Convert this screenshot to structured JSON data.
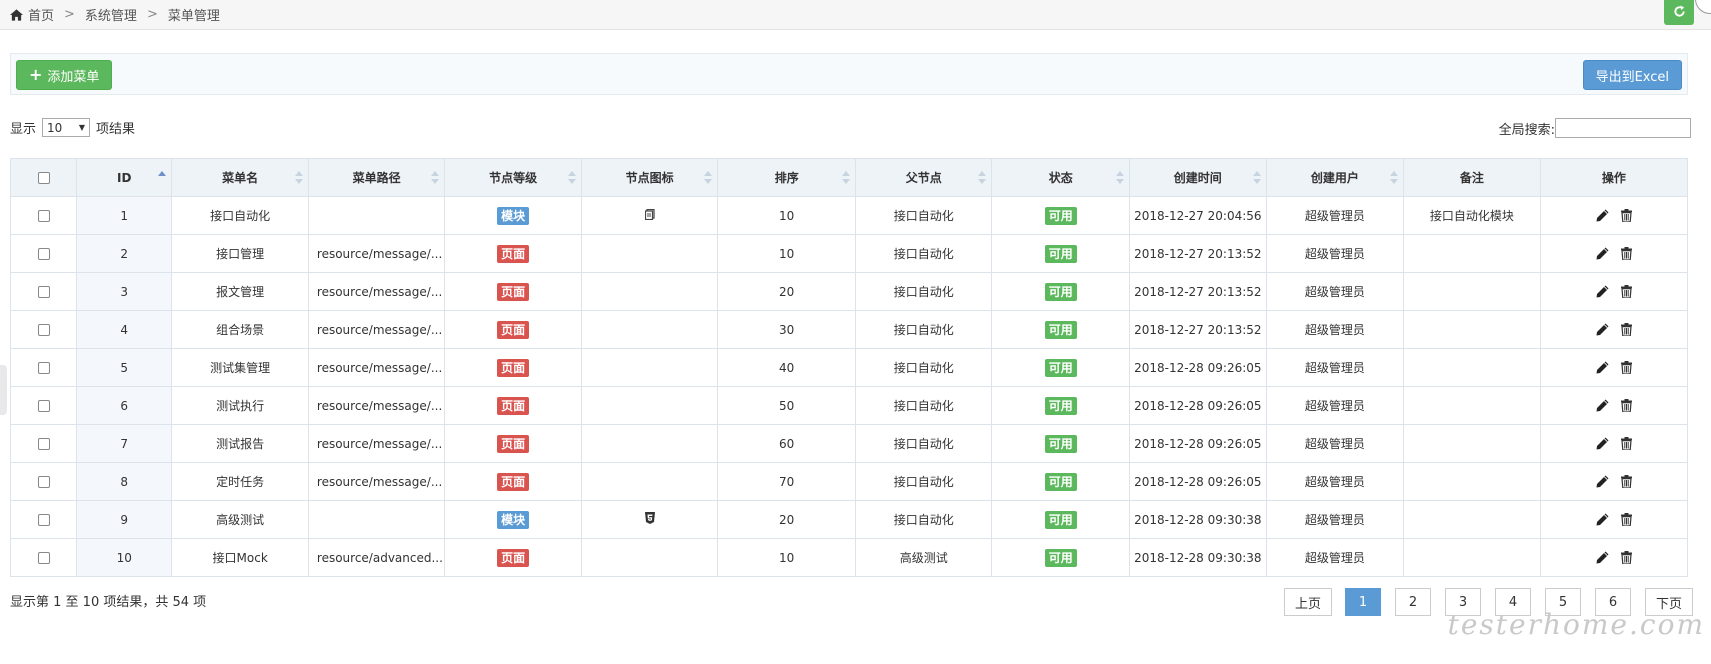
{
  "breadcrumb": {
    "home": "首页",
    "sep1": ">",
    "level1": "系统管理",
    "sep2": ">",
    "level2": "菜单管理"
  },
  "toolbar": {
    "add_label": "添加菜单",
    "export_label": "导出到Excel"
  },
  "length": {
    "prefix": "显示",
    "value": "10",
    "suffix": "项结果"
  },
  "search": {
    "label": "全局搜索:",
    "value": ""
  },
  "table": {
    "columns": [
      "ID",
      "菜单名",
      "菜单路径",
      "节点等级",
      "节点图标",
      "排序",
      "父节点",
      "状态",
      "创建时间",
      "创建用户",
      "备注",
      "操作"
    ],
    "rows": [
      {
        "id": "1",
        "name": "接口自动化",
        "path": "",
        "level": "模块",
        "icon": "file-icon",
        "order": "10",
        "parent": "接口自动化",
        "status": "可用",
        "created": "2018-12-27 20:04:56",
        "user": "超级管理员",
        "note": "接口自动化模块"
      },
      {
        "id": "2",
        "name": "接口管理",
        "path": "resource/message/...",
        "level": "页面",
        "icon": "",
        "order": "10",
        "parent": "接口自动化",
        "status": "可用",
        "created": "2018-12-27 20:13:52",
        "user": "超级管理员",
        "note": ""
      },
      {
        "id": "3",
        "name": "报文管理",
        "path": "resource/message/...",
        "level": "页面",
        "icon": "",
        "order": "20",
        "parent": "接口自动化",
        "status": "可用",
        "created": "2018-12-27 20:13:52",
        "user": "超级管理员",
        "note": ""
      },
      {
        "id": "4",
        "name": "组合场景",
        "path": "resource/message/...",
        "level": "页面",
        "icon": "",
        "order": "30",
        "parent": "接口自动化",
        "status": "可用",
        "created": "2018-12-27 20:13:52",
        "user": "超级管理员",
        "note": ""
      },
      {
        "id": "5",
        "name": "测试集管理",
        "path": "resource/message/...",
        "level": "页面",
        "icon": "",
        "order": "40",
        "parent": "接口自动化",
        "status": "可用",
        "created": "2018-12-28 09:26:05",
        "user": "超级管理员",
        "note": ""
      },
      {
        "id": "6",
        "name": "测试执行",
        "path": "resource/message/...",
        "level": "页面",
        "icon": "",
        "order": "50",
        "parent": "接口自动化",
        "status": "可用",
        "created": "2018-12-28 09:26:05",
        "user": "超级管理员",
        "note": ""
      },
      {
        "id": "7",
        "name": "测试报告",
        "path": "resource/message/...",
        "level": "页面",
        "icon": "",
        "order": "60",
        "parent": "接口自动化",
        "status": "可用",
        "created": "2018-12-28 09:26:05",
        "user": "超级管理员",
        "note": ""
      },
      {
        "id": "8",
        "name": "定时任务",
        "path": "resource/message/...",
        "level": "页面",
        "icon": "",
        "order": "70",
        "parent": "接口自动化",
        "status": "可用",
        "created": "2018-12-28 09:26:05",
        "user": "超级管理员",
        "note": ""
      },
      {
        "id": "9",
        "name": "高级测试",
        "path": "",
        "level": "模块",
        "icon": "html5-icon",
        "order": "20",
        "parent": "接口自动化",
        "status": "可用",
        "created": "2018-12-28 09:30:38",
        "user": "超级管理员",
        "note": ""
      },
      {
        "id": "10",
        "name": "接口Mock",
        "path": "resource/advanced...",
        "level": "页面",
        "icon": "",
        "order": "10",
        "parent": "高级测试",
        "status": "可用",
        "created": "2018-12-28 09:30:38",
        "user": "超级管理员",
        "note": ""
      }
    ]
  },
  "info": "显示第 1 至 10 项结果，共 54 项",
  "pagination": {
    "prev": "上页",
    "pages": [
      "1",
      "2",
      "3",
      "4",
      "5",
      "6"
    ],
    "current": "1",
    "next": "下页"
  },
  "watermark": "testerhome.com",
  "colors": {
    "green": "#5cb85c",
    "blue": "#5b9bd5",
    "red": "#d9534f",
    "header_bg": "#eef3f8"
  }
}
